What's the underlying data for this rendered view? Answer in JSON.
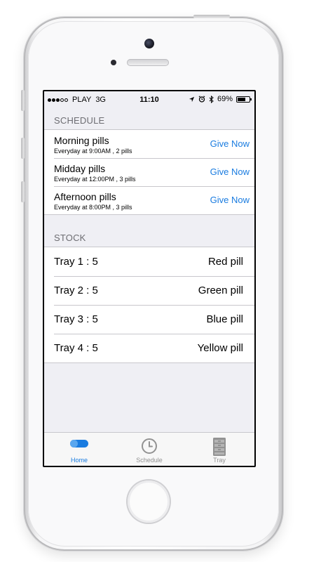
{
  "status_bar": {
    "carrier": "PLAY",
    "network": "3G",
    "time": "11:10",
    "battery_percent": "69%",
    "battery_level": 0.69,
    "signal_dots_filled": 3,
    "signal_dots_total": 5
  },
  "schedule": {
    "header": "SCHEDULE",
    "items": [
      {
        "title": "Morning pills",
        "subtitle": "Everyday at 9:00AM , 2 pills",
        "action": "Give Now"
      },
      {
        "title": "Midday pills",
        "subtitle": "Everyday at 12:00PM , 3 pills",
        "action": "Give Now"
      },
      {
        "title": "Afternoon pills",
        "subtitle": "Everyday at 8:00PM , 3 pills",
        "action": "Give Now"
      }
    ]
  },
  "stock": {
    "header": "STOCK",
    "items": [
      {
        "tray": "Tray 1 : 5",
        "pill": "Red pill"
      },
      {
        "tray": "Tray 2 : 5",
        "pill": "Green pill"
      },
      {
        "tray": "Tray 3 : 5",
        "pill": "Blue pill"
      },
      {
        "tray": "Tray 4 : 5",
        "pill": "Yellow pill"
      }
    ]
  },
  "tab_bar": {
    "tabs": [
      {
        "label": "Home",
        "icon": "pill-icon",
        "active": true
      },
      {
        "label": "Schedule",
        "icon": "clock-icon",
        "active": false
      },
      {
        "label": "Tray",
        "icon": "cabinet-icon",
        "active": false
      }
    ]
  },
  "colors": {
    "accent": "#1a7ce0",
    "inactive": "#929292",
    "background": "#efeff4",
    "separator": "#c8c7cc"
  }
}
